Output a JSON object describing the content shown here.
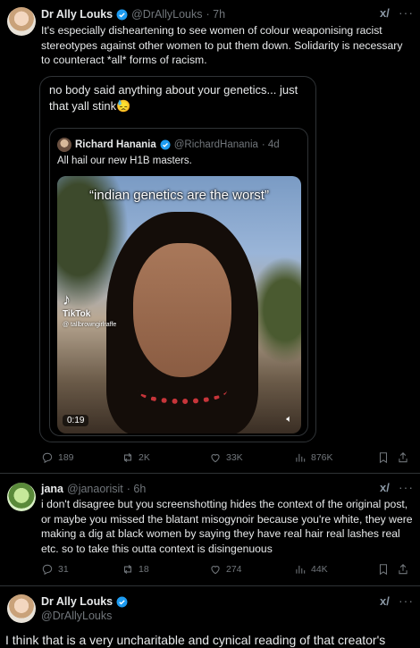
{
  "post1": {
    "name": "Dr Ally Louks",
    "handle": "@DrAllyLouks",
    "time": "· 7h",
    "grok": "x/",
    "more": "···",
    "text": "It's especially disheartening to see women of colour weaponising racist stereotypes against other women to put them down. Solidarity is necessary to counteract *all* forms of racism.",
    "quote": {
      "text": "no body said anything about your genetics... just that yall stink😓",
      "inner": {
        "name": "Richard Hanania",
        "handle": "@RichardHanania",
        "time": "· 4d",
        "text": "All hail our new H1B masters.",
        "video": {
          "caption": "“indian genetics are the worst”",
          "tiktok_label": "TikTok",
          "tiktok_user": "@ tallbrowngirlraffe",
          "duration": "0:19"
        }
      }
    },
    "stats": {
      "replies": "189",
      "reposts": "2K",
      "likes": "33K",
      "views": "876K"
    }
  },
  "post2": {
    "name": "jana",
    "handle": "@janaorisit",
    "time": "· 6h",
    "grok": "x/",
    "more": "···",
    "text": "i don't disagree but you screenshotting hides the context of the original post, or maybe you missed the blatant misogynoir because you're white, they were making a dig at black women by saying they have real hair real lashes real etc. so to take this outta context is disingenuous",
    "stats": {
      "replies": "31",
      "reposts": "18",
      "likes": "274",
      "views": "44K"
    }
  },
  "post3": {
    "name": "Dr Ally Louks",
    "handle": "@DrAllyLouks",
    "grok": "x/",
    "more": "···",
    "text": "I think that is a very uncharitable and cynical reading of that creator's"
  },
  "colors": {
    "background": "#000000",
    "text": "#e7e9ea",
    "muted": "#71767b",
    "verified": "#1d9bf0",
    "border": "#2f3336"
  }
}
